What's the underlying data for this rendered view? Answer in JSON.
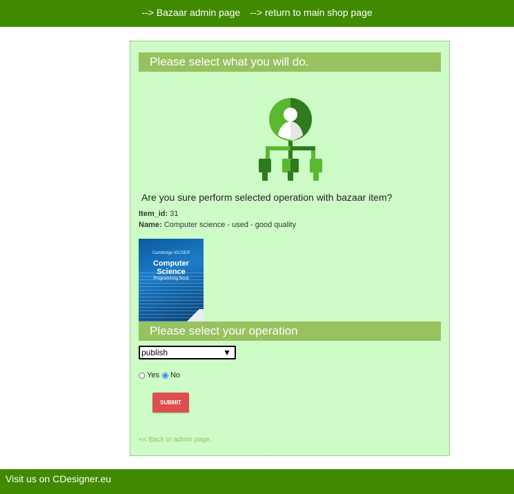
{
  "nav": {
    "admin_link": "--> Bazaar admin page",
    "shop_link": "--> return to main shop page"
  },
  "panel": {
    "heading": "Please select what you will do.",
    "question": "Are you sure perform selected operation with bazaar item?",
    "item_id_label": "Item_id:",
    "item_id_value": "31",
    "name_label": "Name:",
    "name_value": "Computer science - used - good quality",
    "book": {
      "publisher": "Cambridge IGCSE®",
      "title_line1": "Computer",
      "title_line2": "Science",
      "subtitle": "Programming Book"
    },
    "operation_heading": "Please select your operation",
    "operation_select": {
      "selected": "publish",
      "arrow": "▼"
    },
    "radio": {
      "yes_label": "Yes",
      "no_label": "No",
      "selected": "No"
    },
    "submit_label": "SUBMIT",
    "back_link": "<< Back to admin page."
  },
  "footer": {
    "text": "Visit us on CDesigner.eu"
  },
  "colors": {
    "brand_green": "#418a00",
    "panel_bg": "#cdfcc6",
    "heading_bg": "#98c160",
    "submit_bg": "#dd4f4f",
    "icon_light_green": "#5ab82f",
    "icon_dark_green": "#2f7a1f"
  },
  "icons": {
    "hierarchy_icon": "user-hierarchy-icon"
  }
}
